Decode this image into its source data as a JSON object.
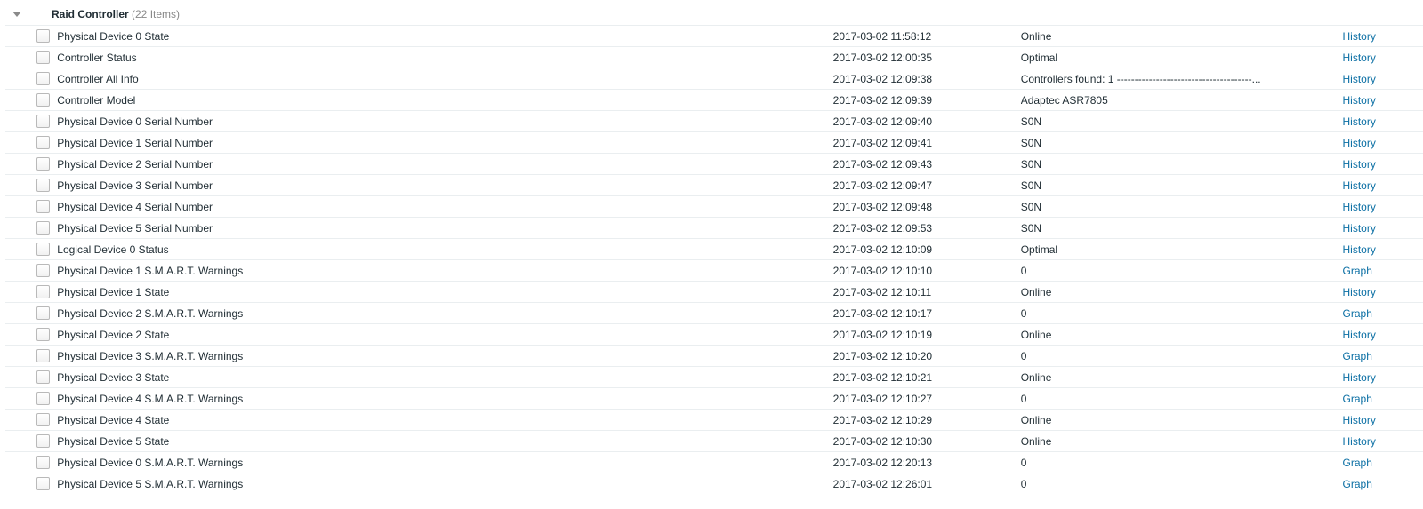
{
  "group": {
    "title": "Raid Controller",
    "count_label": "(22 Items)"
  },
  "link_labels": {
    "history": "History",
    "graph": "Graph"
  },
  "rows": [
    {
      "name": "Physical Device 0 State",
      "time": "2017-03-02 11:58:12",
      "value": "Online",
      "link": "history"
    },
    {
      "name": "Controller Status",
      "time": "2017-03-02 12:00:35",
      "value": "Optimal",
      "link": "history"
    },
    {
      "name": "Controller All Info",
      "time": "2017-03-02 12:09:38",
      "value": "Controllers found: 1 --------------------------------------...",
      "link": "history"
    },
    {
      "name": "Controller Model",
      "time": "2017-03-02 12:09:39",
      "value": "Adaptec ASR7805",
      "link": "history"
    },
    {
      "name": "Physical Device 0 Serial Number",
      "time": "2017-03-02 12:09:40",
      "value": "S0N",
      "link": "history"
    },
    {
      "name": "Physical Device 1 Serial Number",
      "time": "2017-03-02 12:09:41",
      "value": "S0N",
      "link": "history"
    },
    {
      "name": "Physical Device 2 Serial Number",
      "time": "2017-03-02 12:09:43",
      "value": "S0N",
      "link": "history"
    },
    {
      "name": "Physical Device 3 Serial Number",
      "time": "2017-03-02 12:09:47",
      "value": "S0N",
      "link": "history"
    },
    {
      "name": "Physical Device 4 Serial Number",
      "time": "2017-03-02 12:09:48",
      "value": "S0N",
      "link": "history"
    },
    {
      "name": "Physical Device 5 Serial Number",
      "time": "2017-03-02 12:09:53",
      "value": "S0N",
      "link": "history"
    },
    {
      "name": "Logical Device 0 Status",
      "time": "2017-03-02 12:10:09",
      "value": "Optimal",
      "link": "history"
    },
    {
      "name": "Physical Device 1 S.M.A.R.T. Warnings",
      "time": "2017-03-02 12:10:10",
      "value": "0",
      "link": "graph"
    },
    {
      "name": "Physical Device 1 State",
      "time": "2017-03-02 12:10:11",
      "value": "Online",
      "link": "history"
    },
    {
      "name": "Physical Device 2 S.M.A.R.T. Warnings",
      "time": "2017-03-02 12:10:17",
      "value": "0",
      "link": "graph"
    },
    {
      "name": "Physical Device 2 State",
      "time": "2017-03-02 12:10:19",
      "value": "Online",
      "link": "history"
    },
    {
      "name": "Physical Device 3 S.M.A.R.T. Warnings",
      "time": "2017-03-02 12:10:20",
      "value": "0",
      "link": "graph"
    },
    {
      "name": "Physical Device 3 State",
      "time": "2017-03-02 12:10:21",
      "value": "Online",
      "link": "history"
    },
    {
      "name": "Physical Device 4 S.M.A.R.T. Warnings",
      "time": "2017-03-02 12:10:27",
      "value": "0",
      "link": "graph"
    },
    {
      "name": "Physical Device 4 State",
      "time": "2017-03-02 12:10:29",
      "value": "Online",
      "link": "history"
    },
    {
      "name": "Physical Device 5 State",
      "time": "2017-03-02 12:10:30",
      "value": "Online",
      "link": "history"
    },
    {
      "name": "Physical Device 0 S.M.A.R.T. Warnings",
      "time": "2017-03-02 12:20:13",
      "value": "0",
      "link": "graph"
    },
    {
      "name": "Physical Device 5 S.M.A.R.T. Warnings",
      "time": "2017-03-02 12:26:01",
      "value": "0",
      "link": "graph"
    }
  ]
}
